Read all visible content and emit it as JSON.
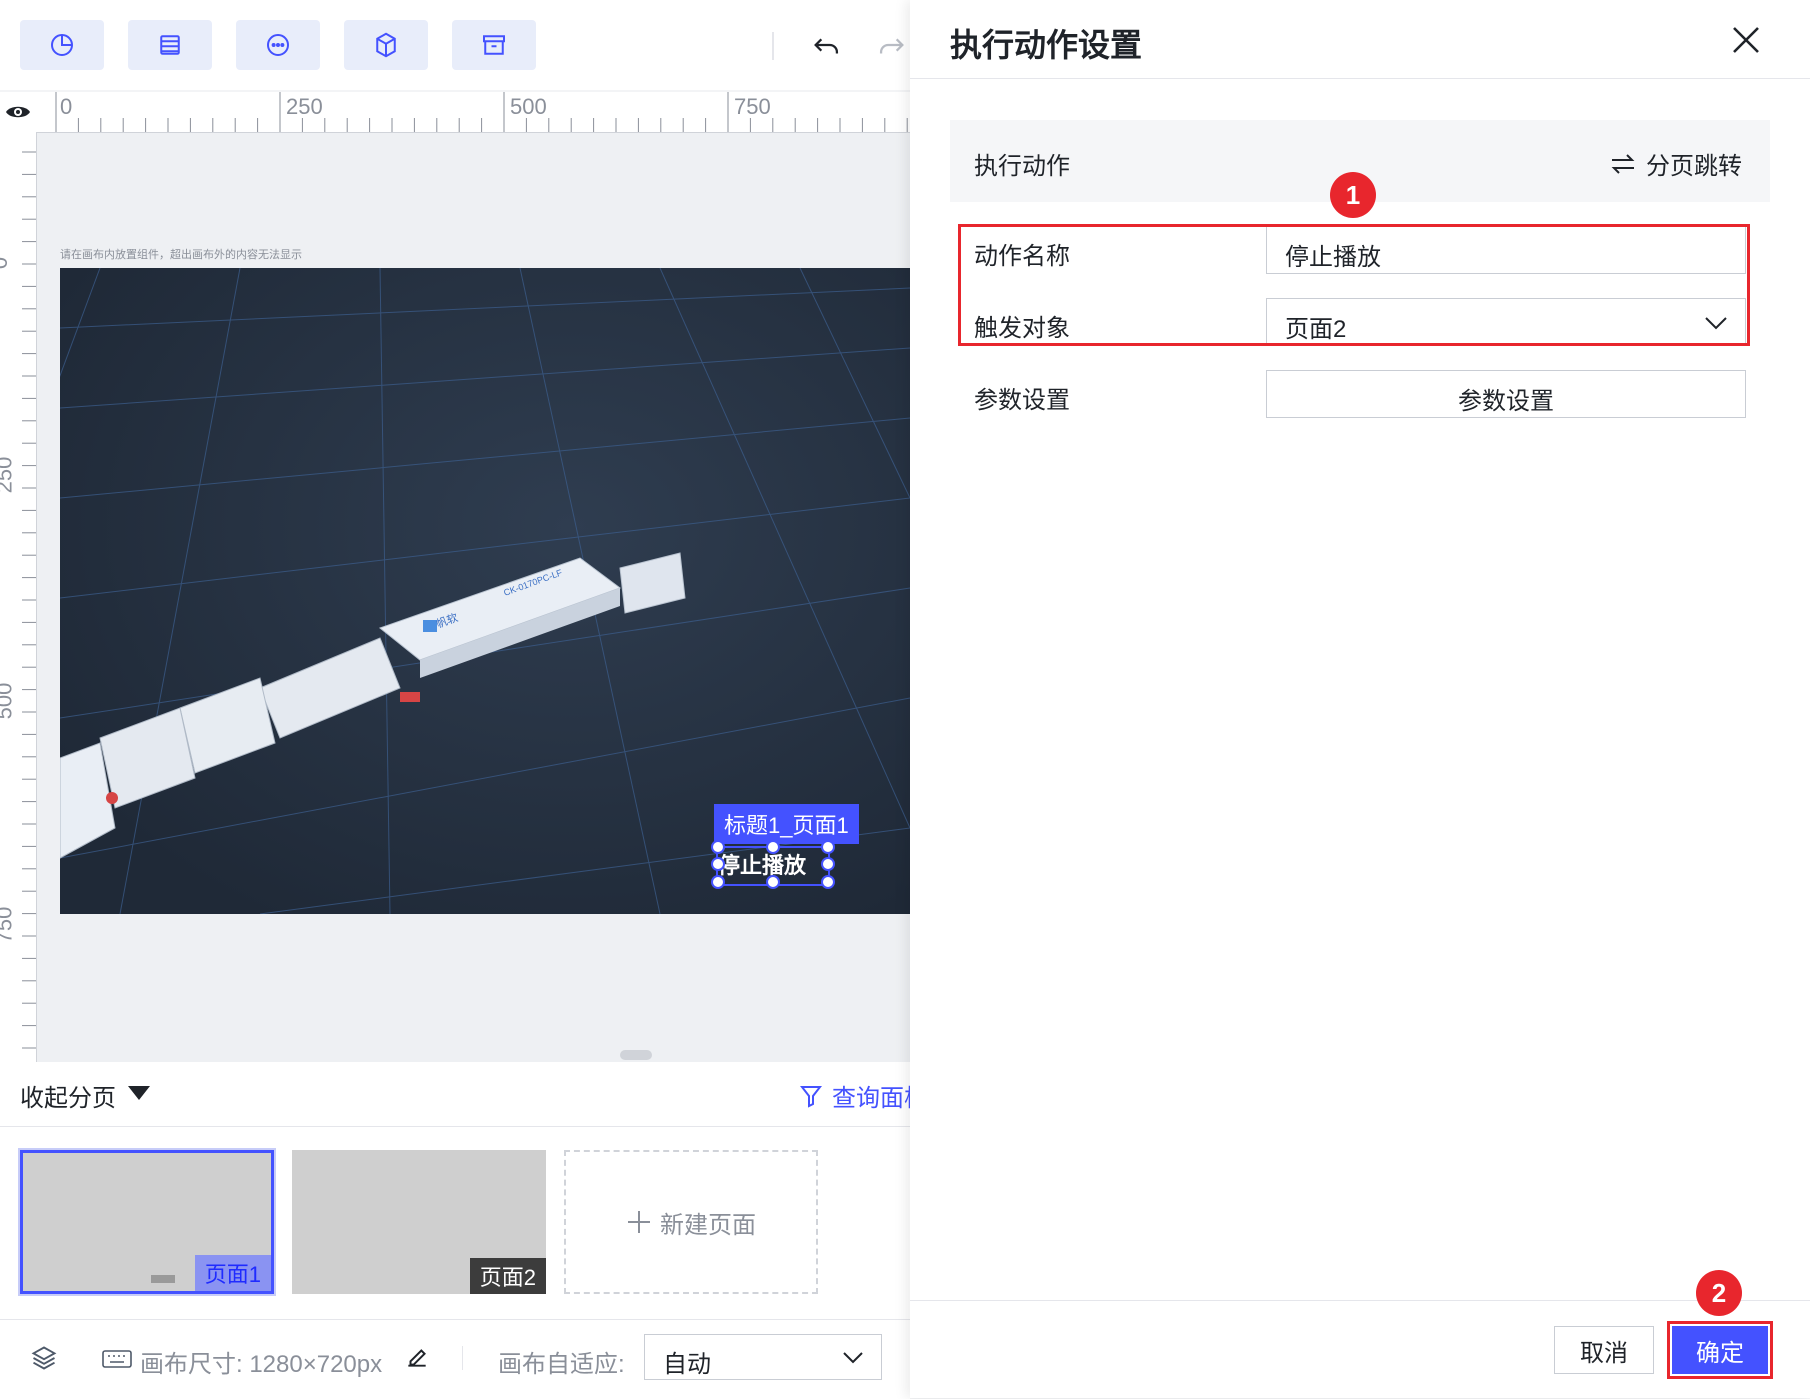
{
  "toolbar": {
    "buttons": [
      {
        "icon": "pie-chart-icon"
      },
      {
        "icon": "layers-list-icon"
      },
      {
        "icon": "more-circle-icon"
      },
      {
        "icon": "cube-icon"
      },
      {
        "icon": "archive-box-icon"
      }
    ],
    "undo_icon": "undo-icon",
    "redo_icon": "redo-icon"
  },
  "ruler": {
    "h_labels": [
      "0",
      "250",
      "500",
      "750"
    ],
    "v_labels": [
      "0",
      "250",
      "500",
      "750"
    ]
  },
  "canvas": {
    "hint": "请在画布内放置组件，超出画布外的内容无法显示",
    "selection_tag": "标题1_页面1",
    "selected_text": "停止播放",
    "machine_label": "CK-0170PC-LF",
    "machine_brand": "帆软"
  },
  "pages": {
    "collapse_label": "收起分页",
    "query_panel_label": "查询面板",
    "items": [
      {
        "label": "页面1",
        "active": true
      },
      {
        "label": "页面2",
        "active": false
      }
    ],
    "new_page_label": "新建页面"
  },
  "bottombar": {
    "canvas_size_label": "画布尺寸: 1280×720px",
    "adapt_label": "画布自适应:",
    "adapt_value": "自动"
  },
  "panel": {
    "title": "执行动作设置",
    "action_label": "执行动作",
    "action_value": "分页跳转",
    "fields": {
      "name_label": "动作名称",
      "name_value": "停止播放",
      "target_label": "触发对象",
      "target_value": "页面2",
      "params_label": "参数设置",
      "params_button": "参数设置"
    },
    "cancel_label": "取消",
    "ok_label": "确定",
    "badges": [
      "1",
      "2"
    ]
  },
  "colors": {
    "accent": "#4452ff",
    "highlight_red": "#e8262d",
    "scene_bg": "#24303f"
  }
}
